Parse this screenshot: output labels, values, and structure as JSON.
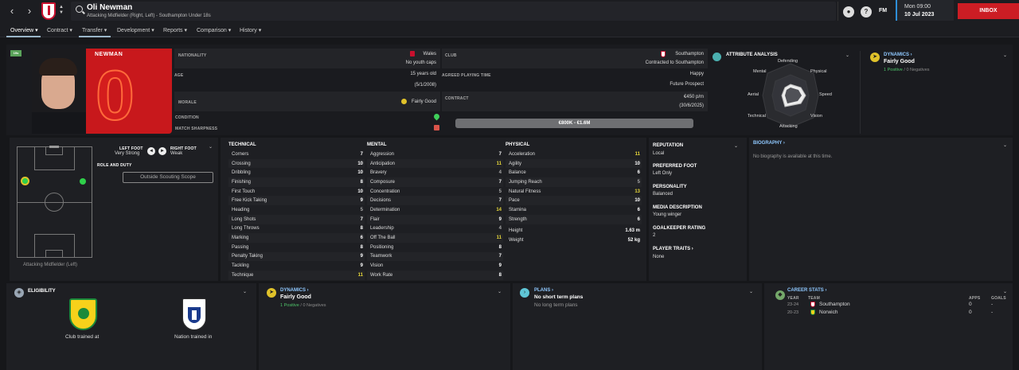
{
  "header": {
    "player_name": "Oli Newman",
    "player_subtitle": "Attacking Midfielder (Right, Left) - Southampton Under 18s",
    "date_line1": "Mon 09:00",
    "date_line2": "10 Jul 2023",
    "inbox_label": "INBOX",
    "fm_label": "FM",
    "help_label": "?"
  },
  "tabs": [
    {
      "label": "Overview"
    },
    {
      "label": "Contract"
    },
    {
      "label": "Transfer"
    },
    {
      "label": "Development"
    },
    {
      "label": "Reports"
    },
    {
      "label": "Comparison"
    },
    {
      "label": "History"
    }
  ],
  "profile": {
    "age_badge": "19s",
    "surname": "NEWMAN",
    "shirt_number": "0"
  },
  "info": {
    "nationality_label": "NATIONALITY",
    "nationality_value": "Wales",
    "nationality_sub": "No youth caps",
    "club_label": "CLUB",
    "club_value": "Southampton",
    "club_sub": "Contracted to Southampton",
    "age_label": "AGE",
    "age_value": "15 years old",
    "age_dob": "(5/1/2008)",
    "apt_label": "AGREED PLAYING TIME",
    "apt_value": "Happy",
    "apt_sub": "Future Prospect",
    "morale_label": "MORALE",
    "morale_value": "Fairly Good",
    "contract_label": "CONTRACT",
    "contract_value": "€450 p/m",
    "contract_date": "(30/6/2025)",
    "condition_label": "CONDITION",
    "sharpness_label": "MATCH SHARPNESS",
    "value_range": "€800K - €1.6M"
  },
  "attr_analysis": {
    "title": "ATTRIBUTE ANALYSIS",
    "labels": [
      "Defending",
      "Physical",
      "Speed",
      "Vision",
      "Attacking",
      "Technical",
      "Aerial",
      "Mental"
    ]
  },
  "dynamics_top": {
    "title": "DYNAMICS",
    "value": "Fairly Good",
    "positive": "1 Positive",
    "sep": "/",
    "negative": "0 Negatives"
  },
  "position": {
    "left_foot_label": "LEFT FOOT",
    "left_foot_value": "Very Strong",
    "right_foot_label": "RIGHT FOOT",
    "right_foot_value": "Weak",
    "role_label": "ROLE AND DUTY",
    "scouting_btn": "Outside Scouting Scope",
    "position_caption": "Attacking Midfielder (Left)"
  },
  "technical": {
    "title": "TECHNICAL",
    "rows": [
      {
        "n": "Corners",
        "v": "7"
      },
      {
        "n": "Crossing",
        "v": "10"
      },
      {
        "n": "Dribbling",
        "v": "10"
      },
      {
        "n": "Finishing",
        "v": "8"
      },
      {
        "n": "First Touch",
        "v": "10"
      },
      {
        "n": "Free Kick Taking",
        "v": "9"
      },
      {
        "n": "Heading",
        "v": "5"
      },
      {
        "n": "Long Shots",
        "v": "7"
      },
      {
        "n": "Long Throws",
        "v": "8"
      },
      {
        "n": "Marking",
        "v": "6"
      },
      {
        "n": "Passing",
        "v": "8"
      },
      {
        "n": "Penalty Taking",
        "v": "9"
      },
      {
        "n": "Tackling",
        "v": "9"
      },
      {
        "n": "Technique",
        "v": "11"
      }
    ]
  },
  "mental": {
    "title": "MENTAL",
    "rows": [
      {
        "n": "Aggression",
        "v": "7"
      },
      {
        "n": "Anticipation",
        "v": "11"
      },
      {
        "n": "Bravery",
        "v": "4"
      },
      {
        "n": "Composure",
        "v": "7"
      },
      {
        "n": "Concentration",
        "v": "5"
      },
      {
        "n": "Decisions",
        "v": "7"
      },
      {
        "n": "Determination",
        "v": "14"
      },
      {
        "n": "Flair",
        "v": "9"
      },
      {
        "n": "Leadership",
        "v": "4"
      },
      {
        "n": "Off The Ball",
        "v": "11"
      },
      {
        "n": "Positioning",
        "v": "8"
      },
      {
        "n": "Teamwork",
        "v": "7"
      },
      {
        "n": "Vision",
        "v": "9"
      },
      {
        "n": "Work Rate",
        "v": "8"
      }
    ]
  },
  "physical": {
    "title": "PHYSICAL",
    "rows": [
      {
        "n": "Acceleration",
        "v": "11"
      },
      {
        "n": "Agility",
        "v": "10"
      },
      {
        "n": "Balance",
        "v": "6"
      },
      {
        "n": "Jumping Reach",
        "v": "5"
      },
      {
        "n": "Natural Fitness",
        "v": "13"
      },
      {
        "n": "Pace",
        "v": "10"
      },
      {
        "n": "Stamina",
        "v": "6"
      },
      {
        "n": "Strength",
        "v": "6"
      }
    ],
    "height_label": "Height",
    "height_value": "1.63 m",
    "weight_label": "Weight",
    "weight_value": "52 kg"
  },
  "reputation": {
    "title": "REPUTATION",
    "value": "Local",
    "pref_foot_label": "PREFERRED FOOT",
    "pref_foot_value": "Left Only",
    "personality_label": "PERSONALITY",
    "personality_value": "Balanced",
    "media_label": "MEDIA DESCRIPTION",
    "media_value": "Young winger",
    "gk_label": "GOALKEEPER RATING",
    "gk_value": "2",
    "traits_label": "PLAYER TRAITS",
    "traits_value": "None"
  },
  "biography": {
    "title": "BIOGRAPHY",
    "text": "No biography is available at this time."
  },
  "eligibility": {
    "title": "ELIGIBILITY",
    "club_caption": "Club trained at",
    "nation_caption": "Nation trained in"
  },
  "dynamics_bottom": {
    "title": "DYNAMICS",
    "value": "Fairly Good",
    "positive": "1 Positive",
    "sep": "/",
    "negative": "0 Negatives"
  },
  "plans": {
    "title": "PLANS",
    "short": "No short term plans",
    "long": "No long term plans"
  },
  "career": {
    "title": "CAREER STATS",
    "col_year": "YEAR",
    "col_team": "TEAM",
    "col_apps": "APPS",
    "col_goals": "GOALS",
    "rows": [
      {
        "year": "23-24",
        "team": "Southampton",
        "apps": "0",
        "goals": "-"
      },
      {
        "year": "20-23",
        "team": "Norwich",
        "apps": "0",
        "goals": "-"
      }
    ]
  }
}
